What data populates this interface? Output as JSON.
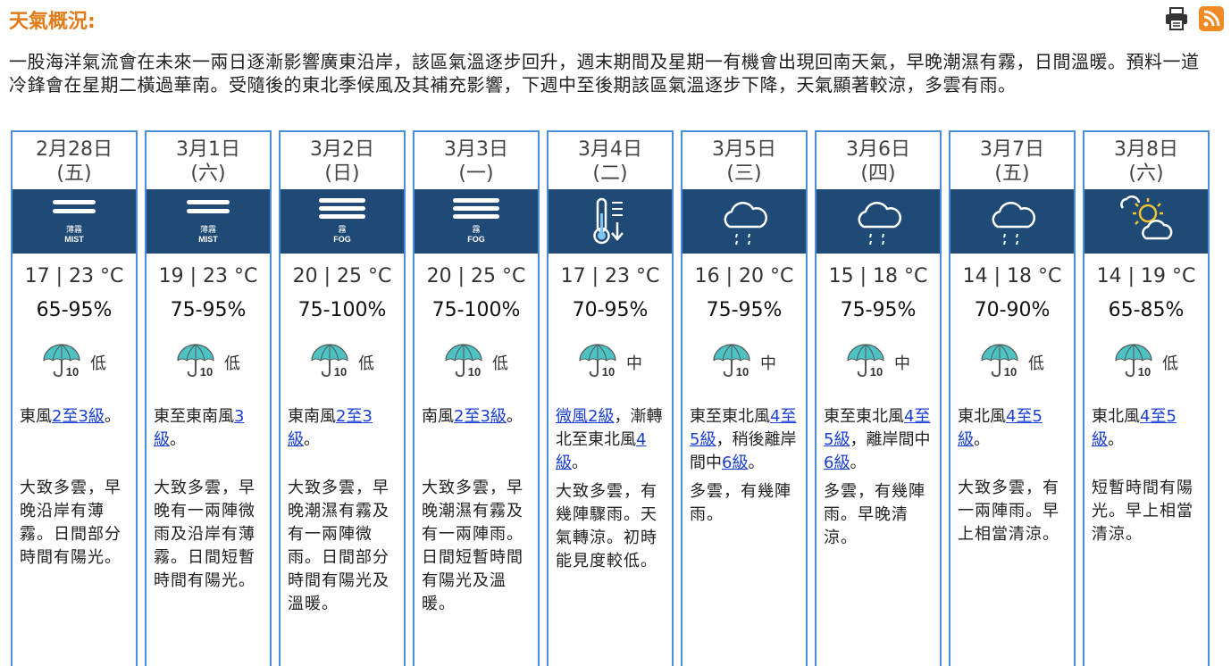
{
  "header": {
    "title": "天氣概況:",
    "print_icon": "printer-icon",
    "rss_icon": "rss-icon"
  },
  "summary": "一股海洋氣流會在未來一兩日逐漸影響廣東沿岸，該區氣溫逐步回升，週末期間及星期一有機會出現回南天氣，早晚潮濕有霧，日間溫暖。預料一道冷鋒會在星期二橫過華南。受隨後的東北季候風及其補充影響，下週中至後期該區氣溫逐步下降，天氣顯著較涼，多雲有雨。",
  "days": [
    {
      "date": "2月28日",
      "weekday": "(五)",
      "icon": "mist",
      "icon_label_zh": "薄霧",
      "icon_label_en": "MIST",
      "temp": "17 | 23 °C",
      "rh": "65-95%",
      "psr": "低",
      "psr_num": "10",
      "wind_pre": "東風",
      "wind_link": "2至3級",
      "wind_post": "。",
      "weather": "大致多雲，早晚沿岸有薄霧。日間部分時間有陽光。"
    },
    {
      "date": "3月1日",
      "weekday": "(六)",
      "icon": "mist",
      "icon_label_zh": "薄霧",
      "icon_label_en": "MIST",
      "temp": "19 | 23 °C",
      "rh": "75-95%",
      "psr": "低",
      "psr_num": "10",
      "wind_pre": "東至東南風",
      "wind_link": "3級",
      "wind_post": "。",
      "weather": "大致多雲，早晚有一兩陣微雨及沿岸有薄霧。日間短暫時間有陽光。"
    },
    {
      "date": "3月2日",
      "weekday": "(日)",
      "icon": "fog",
      "icon_label_zh": "霧",
      "icon_label_en": "FOG",
      "temp": "20 | 25 °C",
      "rh": "75-100%",
      "psr": "低",
      "psr_num": "10",
      "wind_pre": "東南風",
      "wind_link": "2至3級",
      "wind_post": "。",
      "weather": "大致多雲，早晚潮濕有霧及有一兩陣微雨。日間部分時間有陽光及溫暖。"
    },
    {
      "date": "3月3日",
      "weekday": "(一)",
      "icon": "fog",
      "icon_label_zh": "霧",
      "icon_label_en": "FOG",
      "temp": "20 | 25 °C",
      "rh": "75-100%",
      "psr": "低",
      "psr_num": "10",
      "wind_pre": "南風",
      "wind_link": "2至3級",
      "wind_post": "。",
      "weather": "大致多雲，早晚潮濕有霧及有一兩陣雨。日間短暫時間有陽光及溫暖。"
    },
    {
      "date": "3月4日",
      "weekday": "(二)",
      "icon": "cold",
      "icon_label_zh": "",
      "icon_label_en": "",
      "temp": "17 | 23 °C",
      "rh": "70-95%",
      "psr": "中",
      "psr_num": "10",
      "wind_pre": "",
      "wind_link": "微風2級",
      "wind_post": "，漸轉北至東北風",
      "wind_link2": "4級",
      "wind_post2": "。",
      "weather": "大致多雲，有幾陣驟雨。天氣轉涼。初時能見度較低。"
    },
    {
      "date": "3月5日",
      "weekday": "(三)",
      "icon": "rain",
      "icon_label_zh": "",
      "icon_label_en": "",
      "temp": "16 | 20 °C",
      "rh": "75-95%",
      "psr": "中",
      "psr_num": "10",
      "wind_pre": "東至東北風",
      "wind_link": "4至5級",
      "wind_post": "，稍後離岸間中",
      "wind_link2": "6級",
      "wind_post2": "。",
      "weather": "多雲，有幾陣雨。"
    },
    {
      "date": "3月6日",
      "weekday": "(四)",
      "icon": "rain",
      "icon_label_zh": "",
      "icon_label_en": "",
      "temp": "15 | 18 °C",
      "rh": "75-95%",
      "psr": "中",
      "psr_num": "10",
      "wind_pre": "東至東北風",
      "wind_link": "4至5級",
      "wind_post": "，離岸間中",
      "wind_link2": "6級",
      "wind_post2": "。",
      "weather": "多雲，有幾陣雨。早晚清涼。"
    },
    {
      "date": "3月7日",
      "weekday": "(五)",
      "icon": "rain",
      "icon_label_zh": "",
      "icon_label_en": "",
      "temp": "14 | 18 °C",
      "rh": "70-90%",
      "psr": "低",
      "psr_num": "10",
      "wind_pre": "東北風",
      "wind_link": "4至5級",
      "wind_post": "。",
      "weather": "大致多雲，有一兩陣雨。早上相當清涼。"
    },
    {
      "date": "3月8日",
      "weekday": "(六)",
      "icon": "sunny-periods",
      "icon_label_zh": "",
      "icon_label_en": "",
      "temp": "14 | 19 °C",
      "rh": "65-85%",
      "psr": "低",
      "psr_num": "10",
      "wind_pre": "東北風",
      "wind_link": "4至5級",
      "wind_post": "。",
      "weather": "短暫時間有陽光。早上相當清涼。"
    }
  ]
}
